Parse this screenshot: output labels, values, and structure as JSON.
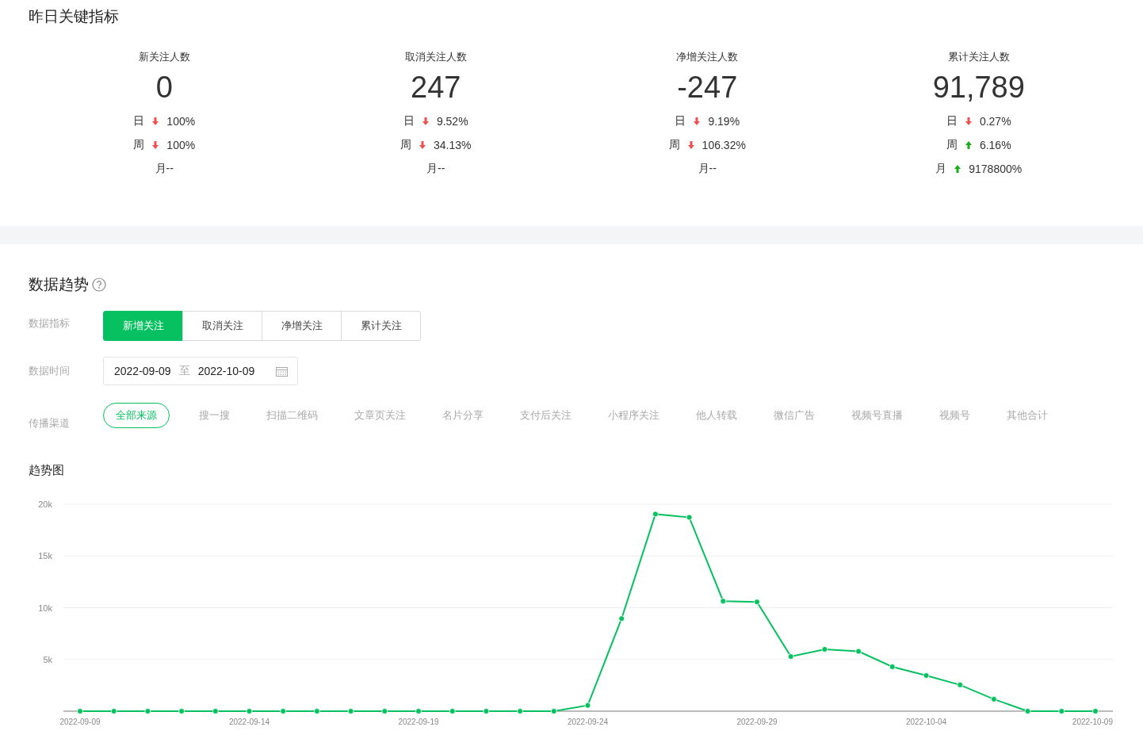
{
  "key_metrics": {
    "title": "昨日关键指标",
    "items": [
      {
        "label": "新关注人数",
        "value": "0",
        "rows": [
          {
            "kind": "down",
            "period": "日",
            "value": "100%"
          },
          {
            "kind": "down",
            "period": "周",
            "value": "100%"
          },
          {
            "kind": "plain",
            "text": "月--"
          }
        ]
      },
      {
        "label": "取消关注人数",
        "value": "247",
        "rows": [
          {
            "kind": "down",
            "period": "日",
            "value": "9.52%"
          },
          {
            "kind": "down",
            "period": "周",
            "value": "34.13%"
          },
          {
            "kind": "plain",
            "text": "月--"
          }
        ]
      },
      {
        "label": "净增关注人数",
        "value": "-247",
        "rows": [
          {
            "kind": "down",
            "period": "日",
            "value": "9.19%"
          },
          {
            "kind": "down",
            "period": "周",
            "value": "106.32%"
          },
          {
            "kind": "plain",
            "text": "月--"
          }
        ]
      },
      {
        "label": "累计关注人数",
        "value": "91,789",
        "rows": [
          {
            "kind": "down",
            "period": "日",
            "value": "0.27%"
          },
          {
            "kind": "up",
            "period": "周",
            "value": "6.16%"
          },
          {
            "kind": "up",
            "period": "月",
            "value": "9178800%"
          }
        ]
      }
    ]
  },
  "trend": {
    "title": "数据趋势",
    "metric_filter": {
      "label": "数据指标",
      "options": [
        {
          "label": "新增关注",
          "selected": true
        },
        {
          "label": "取消关注",
          "selected": false
        },
        {
          "label": "净增关注",
          "selected": false
        },
        {
          "label": "累计关注",
          "selected": false
        }
      ]
    },
    "date_filter": {
      "label": "数据时间",
      "start": "2022-09-09",
      "separator": "至",
      "end": "2022-10-09"
    },
    "channel_filter": {
      "label": "传播渠道",
      "options": [
        {
          "label": "全部来源",
          "selected": true
        },
        {
          "label": "搜一搜",
          "selected": false
        },
        {
          "label": "扫描二维码",
          "selected": false
        },
        {
          "label": "文章页关注",
          "selected": false
        },
        {
          "label": "名片分享",
          "selected": false
        },
        {
          "label": "支付后关注",
          "selected": false
        },
        {
          "label": "小程序关注",
          "selected": false
        },
        {
          "label": "他人转载",
          "selected": false
        },
        {
          "label": "微信广告",
          "selected": false
        },
        {
          "label": "视频号直播",
          "selected": false
        },
        {
          "label": "视频号",
          "selected": false
        },
        {
          "label": "其他合计",
          "selected": false
        }
      ]
    },
    "chart_title": "趋势图",
    "chart_data": {
      "type": "line",
      "categories": [
        "2022-09-09",
        null,
        null,
        null,
        null,
        "2022-09-14",
        null,
        null,
        null,
        null,
        "2022-09-19",
        null,
        null,
        null,
        null,
        "2022-09-24",
        null,
        null,
        null,
        null,
        "2022-09-29",
        null,
        null,
        null,
        null,
        "2022-10-04",
        null,
        null,
        null,
        null,
        "2022-10-09"
      ],
      "grid": true,
      "series": [
        {
          "color": "#07c160",
          "marker": true,
          "values": [
            0,
            0,
            0,
            0,
            0,
            0,
            0,
            0,
            0,
            0,
            0,
            0,
            0,
            0,
            0,
            560,
            8950,
            19050,
            18730,
            10640,
            10560,
            5280,
            5980,
            5780,
            4290,
            3450,
            2540,
            1160,
            0,
            0,
            0
          ]
        }
      ],
      "ylim": [
        0,
        20000
      ],
      "yticks": [
        {
          "value": 5000,
          "label": "5k"
        },
        {
          "value": 10000,
          "label": "10k"
        },
        {
          "value": 15000,
          "label": "15k"
        },
        {
          "value": 20000,
          "label": "20k"
        }
      ]
    }
  }
}
